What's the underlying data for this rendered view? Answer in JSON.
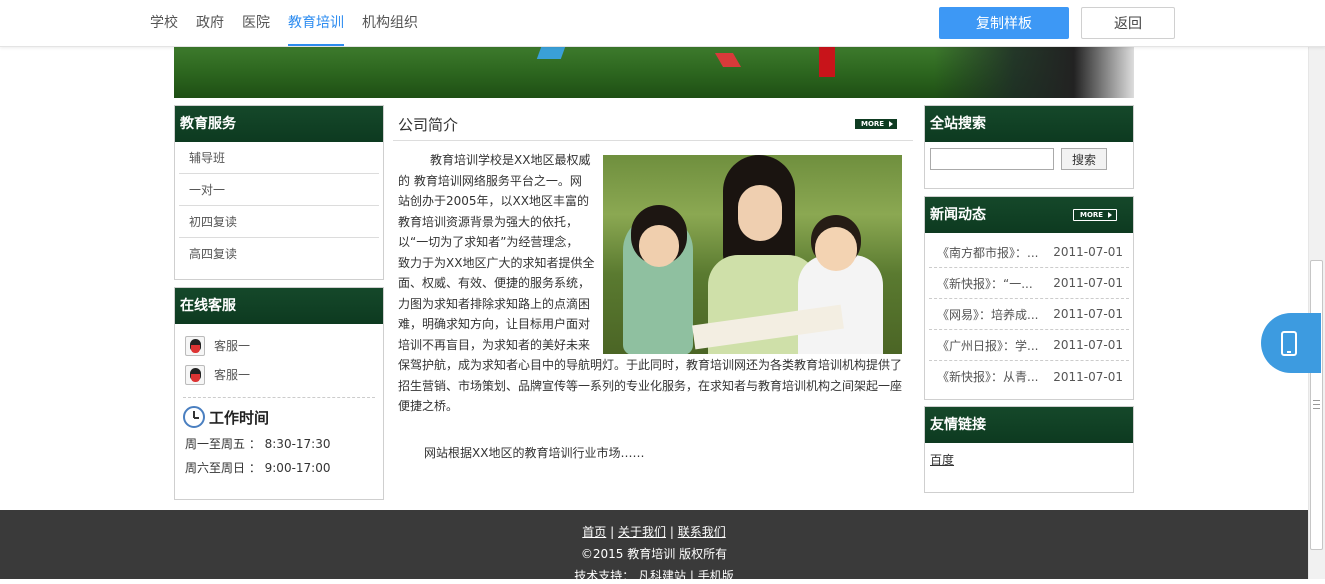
{
  "toolbar": {
    "tabs": [
      {
        "label": "学校"
      },
      {
        "label": "政府"
      },
      {
        "label": "医院"
      },
      {
        "label": "教育培训"
      },
      {
        "label": "机构组织"
      }
    ],
    "active_tab": "教育培训",
    "copy_label": "复制样板",
    "back_label": "返回"
  },
  "sidebar": {
    "services": {
      "title": "教育服务",
      "items": [
        {
          "label": "辅导班"
        },
        {
          "label": "一对一"
        },
        {
          "label": "初四复读"
        },
        {
          "label": "高四复读"
        }
      ]
    },
    "support": {
      "title": "在线客服",
      "items": [
        {
          "label": "客服一"
        },
        {
          "label": "客服一"
        }
      ],
      "worktime_title": "工作时间",
      "worktime_lines": [
        "周一至周五 ： 8:30-17:30",
        "周六至周日 ： 9:00-17:00"
      ]
    }
  },
  "main": {
    "title": "公司简介",
    "more_label": "MORE",
    "lines_narrow": [
      "教育培训学校是XX地区最权威",
      "的 教育培训网络服务平台之一。网",
      "站创办于2005年，以XX地区丰富的",
      "教育培训资源背景为强大的依托，",
      "以“一切为了求知者”为经营理念，",
      "致力于为XX地区广大的求知者提供全",
      "面、权威、有效、便捷的服务系统，",
      "力图为求知者排除求知路上的点滴困",
      "难，明确求知方向，让目标用户面对",
      "培训不再盲目，为求知者的美好未来"
    ],
    "text_wide": "保驾护航，成为求知者心目中的导航明灯。于此同时，教育培训网还为各类教育培训机构提供了招生营销、市场策划、品牌宣传等一系列的专业化服务，在求知者与教育培训机构之间架起一座便捷之桥。",
    "more_text": "网站根据XX地区的教育培训行业市场……"
  },
  "right": {
    "search": {
      "title": "全站搜索",
      "value": "",
      "button": "搜索"
    },
    "news": {
      "title": "新闻动态",
      "more_label": "MORE",
      "items": [
        {
          "title": "《南方都市报》：...",
          "date": "2011-07-01"
        },
        {
          "title": "《新快报》：“一...",
          "date": "2011-07-01"
        },
        {
          "title": "《网易》：培养成...",
          "date": "2011-07-01"
        },
        {
          "title": "《广州日报》：学...",
          "date": "2011-07-01"
        },
        {
          "title": "《新快报》：从青...",
          "date": "2011-07-01"
        }
      ]
    },
    "links": {
      "title": "友情链接",
      "items": [
        {
          "label": "百度"
        }
      ]
    }
  },
  "footer": {
    "links": [
      "首页",
      "关于我们",
      "联系我们"
    ],
    "separator": "|",
    "copyright": "©2015 教育培训 版权所有",
    "support_prefix": "技术支持：",
    "support_link": "凡科建站",
    "mobile_link": "手机版"
  },
  "colors": {
    "accent": "#3d98f5",
    "header_green": "#0d3a20",
    "footer_bg": "#3a3a3a"
  }
}
